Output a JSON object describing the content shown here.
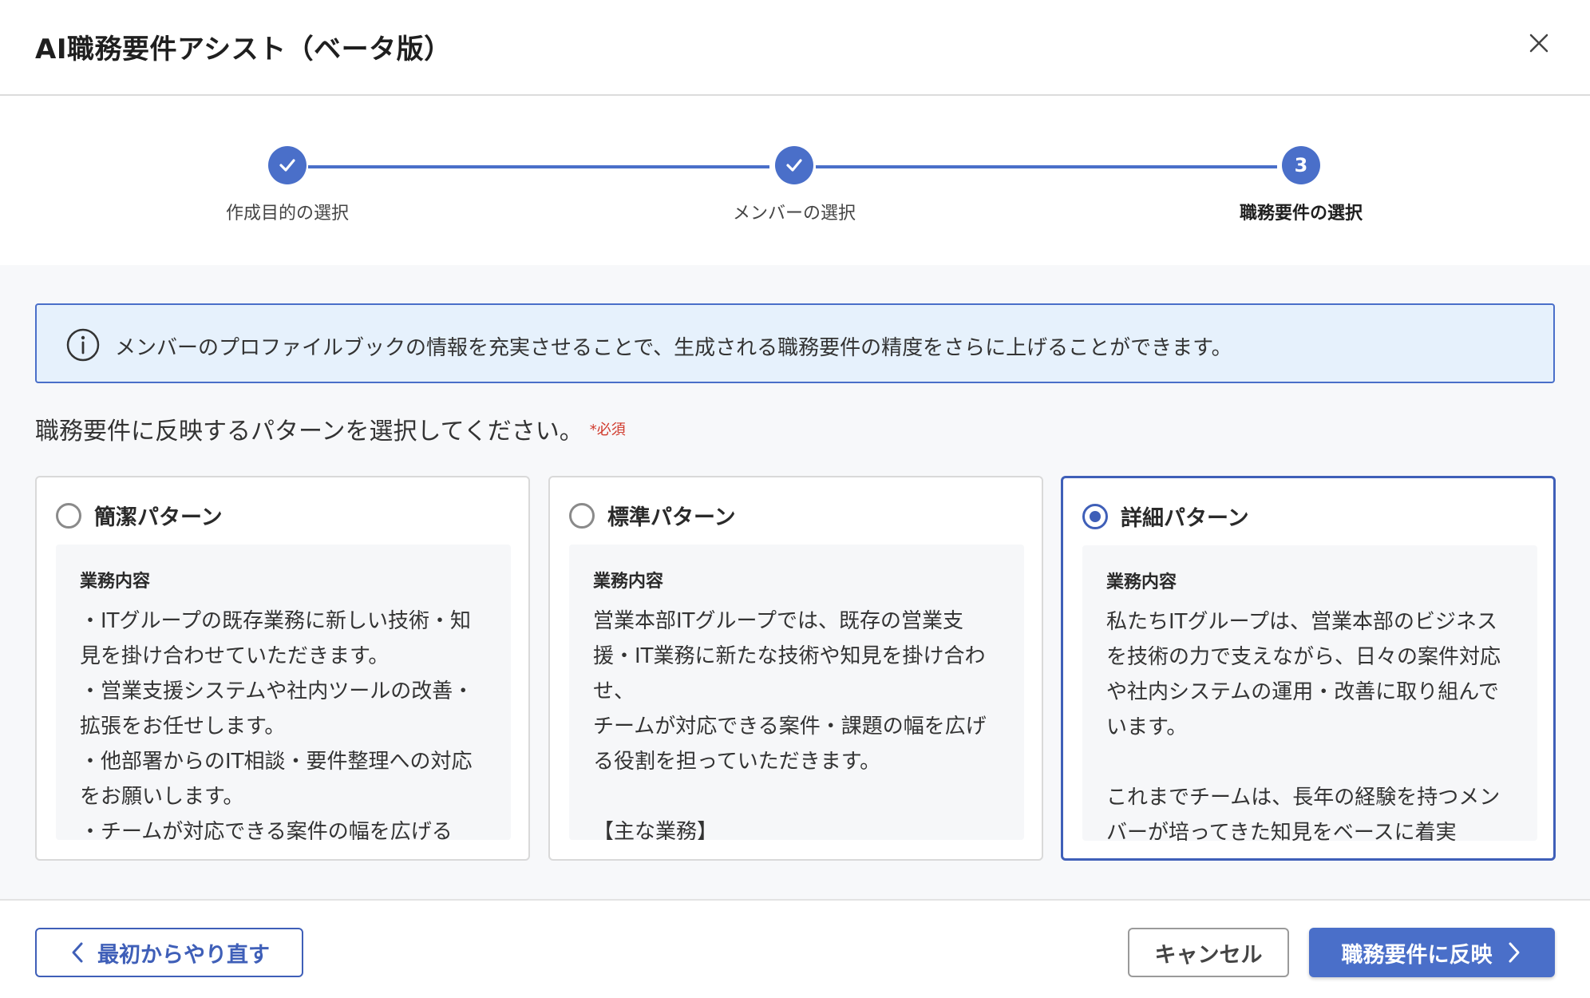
{
  "dialog": {
    "title": "AI職務要件アシスト（ベータ版）",
    "close_icon": "close-icon"
  },
  "stepper": {
    "steps": [
      {
        "label": "作成目的の選択",
        "state": "done",
        "icon": "check-icon"
      },
      {
        "label": "メンバーの選択",
        "state": "done",
        "icon": "check-icon"
      },
      {
        "label": "職務要件の選択",
        "state": "current",
        "number": "3"
      }
    ],
    "accent_color": "#4a6fc9"
  },
  "info": {
    "icon": "info-icon",
    "text": "メンバーのプロファイルブックの情報を充実させることで、生成される職務要件の精度をさらに上げることができます。"
  },
  "question": {
    "text": "職務要件に反映するパターンを選択してください。",
    "required": "*必須"
  },
  "patterns": [
    {
      "title": "簡潔パターン",
      "selected": false,
      "body_heading": "業務内容",
      "body_text": "・ITグループの既存業務に新しい技術・知見を掛け合わせていただきます。\n・営業支援システムや社内ツールの改善・拡張をお任せします。\n・他部署からのIT相談・要件整理への対応をお願いします。\n・チームが対応できる案件の幅を広げる"
    },
    {
      "title": "標準パターン",
      "selected": false,
      "body_heading": "業務内容",
      "body_text": "営業本部ITグループでは、既存の営業支援・IT業務に新たな技術や知見を掛け合わせ、\nチームが対応できる案件・課題の幅を広げる役割を担っていただきます。\n\n【主な業務】"
    },
    {
      "title": "詳細パターン",
      "selected": true,
      "body_heading": "業務内容",
      "body_text": "私たちITグループは、営業本部のビジネスを技術の力で支えながら、日々の案件対応や社内システムの運用・改善に取り組んでいます。\n\nこれまでチームは、長年の経験を持つメンバーが培ってきた知見をベースに着実"
    }
  ],
  "footer": {
    "restart_label": "最初からやり直す",
    "cancel_label": "キャンセル",
    "apply_label": "職務要件に反映"
  }
}
